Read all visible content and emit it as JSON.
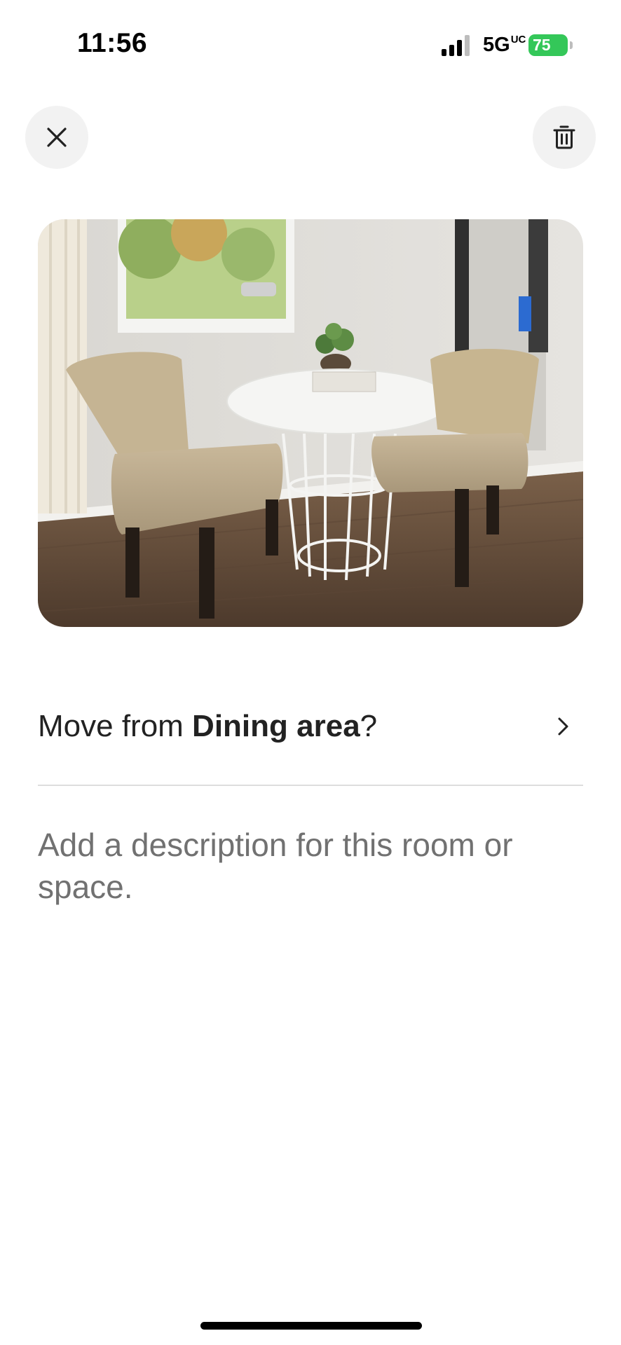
{
  "status_bar": {
    "time": "11:56",
    "network": "5G",
    "network_suffix": "UC",
    "battery": "75"
  },
  "header": {
    "close_icon": "close-icon",
    "delete_icon": "trash-icon"
  },
  "photo": {
    "description_icon": "room-photo"
  },
  "move": {
    "prefix": "Move from ",
    "room": "Dining area",
    "suffix": "?"
  },
  "description": {
    "placeholder": "Add a description for this room or space."
  },
  "colors": {
    "battery": "#34c759",
    "button_bg": "#f2f2f2",
    "placeholder": "#717171",
    "text": "#222222"
  }
}
